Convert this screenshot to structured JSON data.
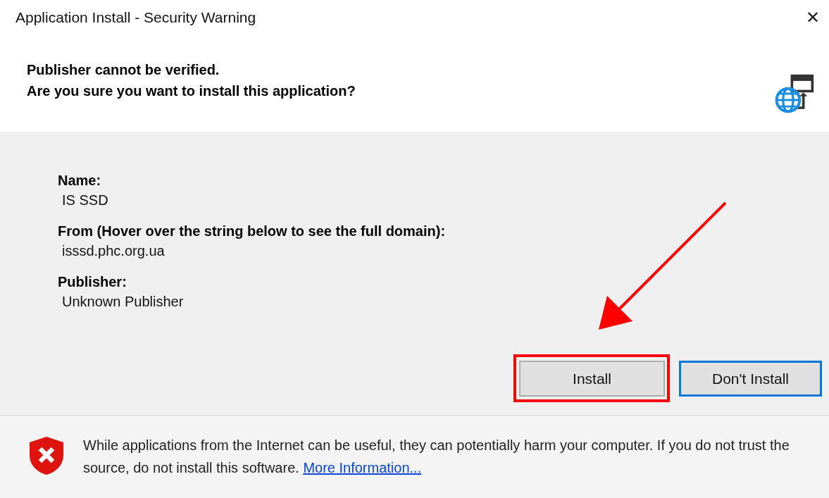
{
  "window": {
    "title": "Application Install - Security Warning",
    "close": "✕"
  },
  "header": {
    "lines": [
      "Publisher cannot be verified.",
      "Are you sure you want to install this application?"
    ]
  },
  "details": [
    {
      "label": "Name:",
      "value": "IS SSD"
    },
    {
      "label": "From (Hover over the string below to see the full domain):",
      "value": "isssd.phc.org.ua"
    },
    {
      "label": "Publisher:",
      "value": "Unknown Publisher"
    }
  ],
  "buttons": [
    {
      "label": "Install",
      "focused": false,
      "highlighted": true
    },
    {
      "label": "Don't Install",
      "focused": true,
      "highlighted": false
    }
  ],
  "footer": {
    "text": "While applications from the Internet can be useful, they can potentially harm your computer. If you do not trust the source, do not install this software.",
    "link": "More Information..."
  }
}
